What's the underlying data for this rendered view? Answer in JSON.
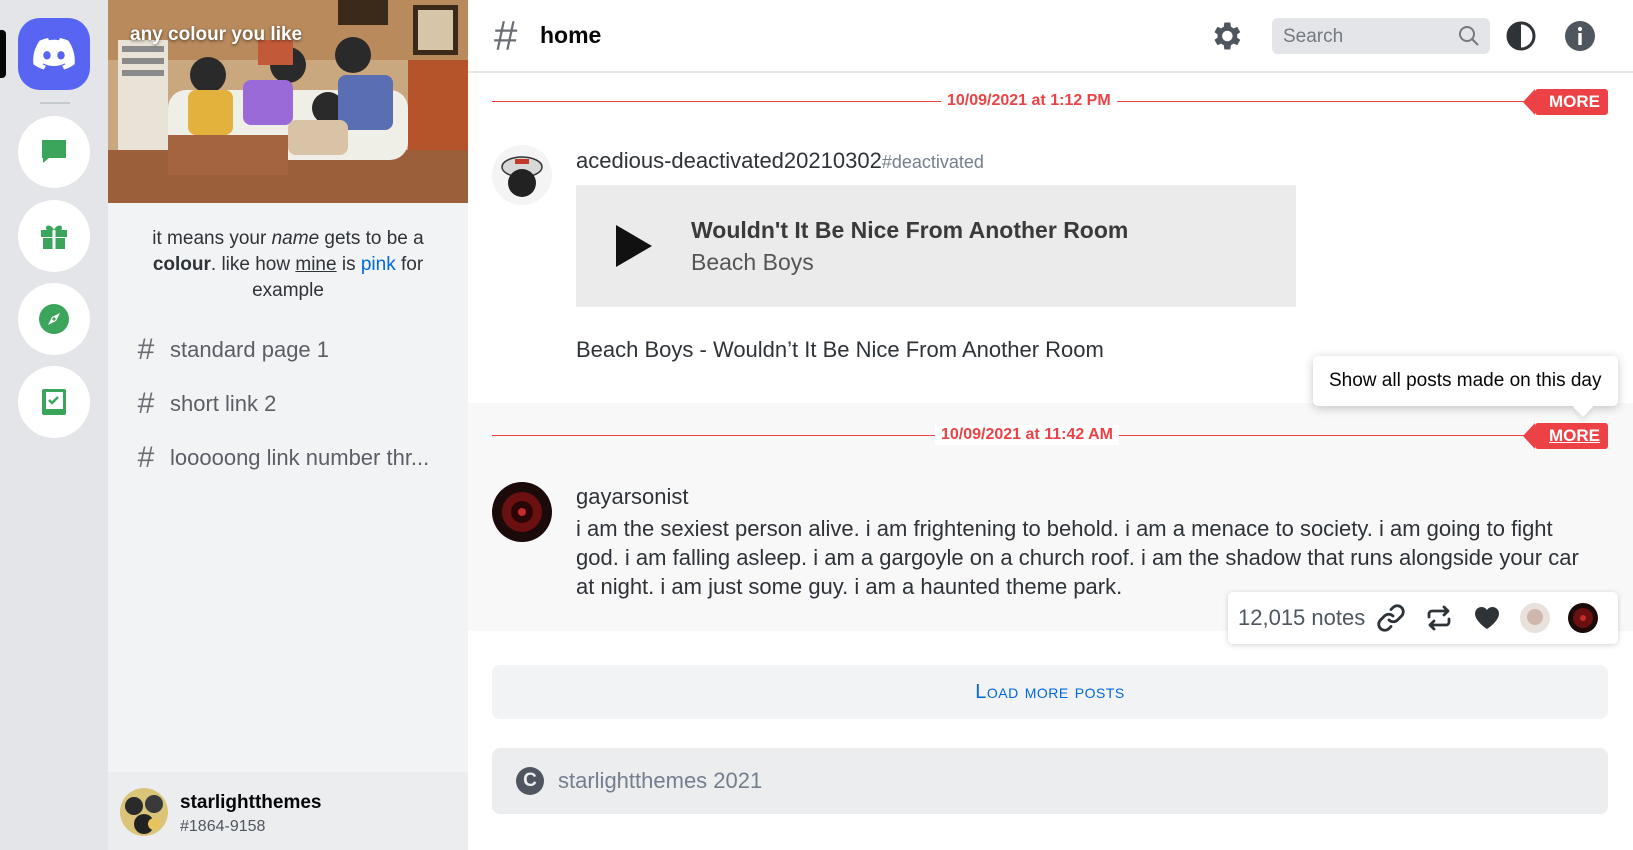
{
  "rail": {
    "items": [
      {
        "name": "discord-home",
        "icon": "discord-logo-icon"
      },
      {
        "name": "messages",
        "icon": "chat-bubble-icon"
      },
      {
        "name": "gifts",
        "icon": "gift-icon"
      },
      {
        "name": "explore",
        "icon": "compass-icon"
      },
      {
        "name": "tasks",
        "icon": "checklist-book-icon"
      }
    ],
    "accent_color": "#5865f2",
    "icon_color": "#3ba55c"
  },
  "sidebar": {
    "banner_title": "any colour you like",
    "description": {
      "part1": "it means your ",
      "name_word": "name",
      "part2": " gets to be a ",
      "colour_word": "colour",
      "part3": ". like how ",
      "mine_word": "mine",
      "part4": " is ",
      "pink_word": "pink",
      "part5": " for example"
    },
    "channels": [
      {
        "label": "standard page 1"
      },
      {
        "label": "short link 2"
      },
      {
        "label": "looooong link number thr..."
      }
    ],
    "user": {
      "name": "starlightthemes",
      "tag": "#1864-9158"
    }
  },
  "header": {
    "channel": "home",
    "search_placeholder": "Search",
    "icons": [
      "gear-icon",
      "search-icon",
      "contrast-icon",
      "info-icon"
    ]
  },
  "posts": [
    {
      "date": "10/09/2021 at 1:12 PM",
      "more_label": "MORE",
      "username": "acedious-deactivated20210302",
      "user_tag": "#deactivated",
      "audio": {
        "title": "Wouldn't It Be Nice From Another Room",
        "artist": "Beach Boys"
      },
      "caption": "Beach Boys - Wouldn’t It Be Nice From Another Room"
    },
    {
      "date": "10/09/2021 at 11:42 AM",
      "more_label": "MORE",
      "username": "gayarsonist",
      "text": "i am the sexiest person alive. i am frightening to behold. i am a menace to society. i am going to fight god. i am falling asleep. i am a gargoyle on a church roof. i am the shadow that runs alongside your car at night. i am just some guy. i am a haunted theme park.",
      "notes": "12,015 notes"
    }
  ],
  "tooltip": "Show all posts made on this day",
  "load_more": "Load more posts",
  "footer": {
    "icon": "C",
    "text": "starlightthemes 2021"
  },
  "colors": {
    "red": "#ed4245",
    "link_blue": "#0068e0"
  }
}
